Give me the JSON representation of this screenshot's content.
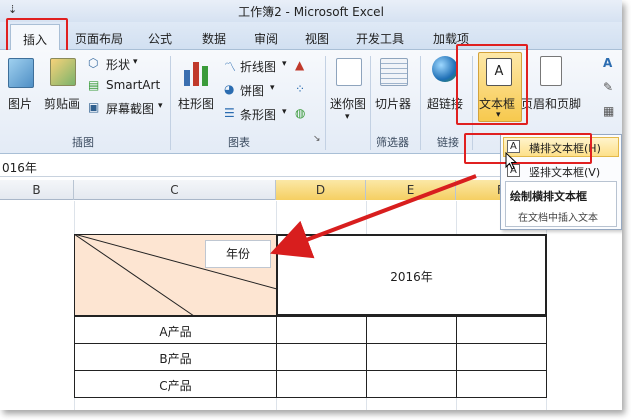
{
  "window": {
    "qat_symbol": "⇣",
    "title": "工作簿2 - Microsoft Excel"
  },
  "tabs": [
    "插入",
    "页面布局",
    "公式",
    "数据",
    "审阅",
    "视图",
    "开发工具",
    "加载项"
  ],
  "ribbon": {
    "illustrations": {
      "picture": "图片",
      "clipart": "剪贴画",
      "shapes": "形状",
      "smartart": "SmartArt",
      "screenshot": "屏幕截图",
      "group_label": "插图"
    },
    "charts": {
      "column": "柱形图",
      "line": "折线图",
      "pie": "饼图",
      "bar": "条形图",
      "group_label": "图表"
    },
    "sparklines": {
      "sparkline": "迷你图"
    },
    "filter": {
      "slicer": "切片器",
      "group_label": "筛选器"
    },
    "links": {
      "hyperlink": "超链接",
      "group_label": "链接"
    },
    "text": {
      "textbox": "文本框",
      "header_footer": "页眉和页脚"
    }
  },
  "textbox_menu": {
    "horizontal": "横排文本框(H)",
    "vertical": "竖排文本框(V)",
    "tooltip_title": "绘制横排文本框",
    "tooltip_desc": "在文档中插入文本"
  },
  "formula_bar": {
    "value": "016年"
  },
  "columns": [
    "B",
    "C",
    "D",
    "E",
    "F"
  ],
  "sheet": {
    "textbox_text": "年份",
    "header_value": "2016年",
    "rows": [
      "A产品",
      "B产品",
      "C产品"
    ]
  },
  "colors": {
    "highlight_red": "#e02020",
    "selected_column": "#f5cf62",
    "header_cell_fill": "#fde5d2"
  }
}
